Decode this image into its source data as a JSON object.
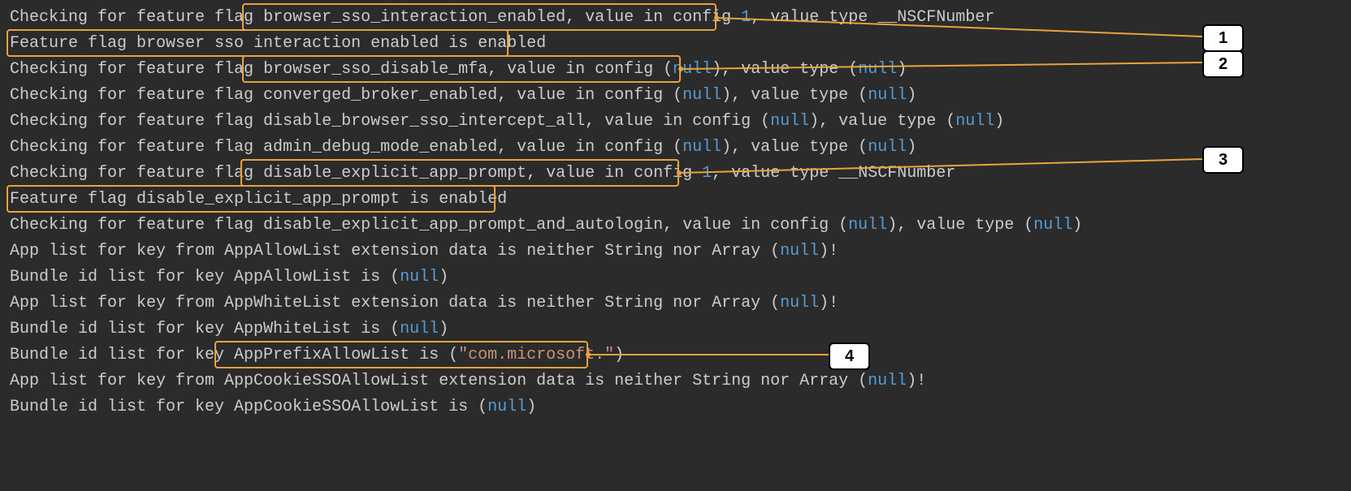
{
  "log": {
    "l1_pre": "Checking for feature flag ",
    "l1_hl": "browser_sso_interaction_enabled, value in config ",
    "l1_num": "1",
    "l1_post": ", value type __NSCFNumber",
    "l2_hl": "Feature flag browser sso interaction enabled is enabled",
    "l3_pre": "Checking for feature flag ",
    "l3_hl": "browser_sso_disable_mfa, value in config (",
    "l3_null": "null",
    "l3_hl2": ")",
    "l3_post1": ", value type (",
    "l3_null2": "null",
    "l3_post2": ")",
    "l4_pre": "Checking for feature flag converged_broker_enabled, value in config (",
    "l4_null": "null",
    "l4_mid": "), value type (",
    "l4_null2": "null",
    "l4_post": ")",
    "l5_pre": "Checking for feature flag disable_browser_sso_intercept_all, value in config (",
    "l5_null": "null",
    "l5_mid": "), value type (",
    "l5_null2": "null",
    "l5_post": ")",
    "l6_pre": "Checking for feature flag admin_debug_mode_enabled, value in config (",
    "l6_null": "null",
    "l6_mid": "), value type (",
    "l6_null2": "null",
    "l6_post": ")",
    "l7_pre": "Checking for feature flag ",
    "l7_hl": "disable_explicit_app_prompt, value in config ",
    "l7_num": "1",
    "l7_post": ", value type __NSCFNumber",
    "l8_hl": "Feature flag disable_explicit_app_prompt is enabled",
    "l9_pre": "Checking for feature flag disable_explicit_app_prompt_and_autologin, value in config (",
    "l9_null": "null",
    "l9_mid": "), value type (",
    "l9_null2": "null",
    "l9_post": ")",
    "l10_pre": "App list for key from AppAllowList extension data is neither String nor Array (",
    "l10_null": "null",
    "l10_post": ")!",
    "l11_pre": "Bundle id list for key AppAllowList is (",
    "l11_null": "null",
    "l11_post": ")",
    "l12_pre": "App list for key from AppWhiteList extension data is neither String nor Array (",
    "l12_null": "null",
    "l12_post": ")!",
    "l13_pre": "Bundle id list for key AppWhiteList is (",
    "l13_null": "null",
    "l13_post": ")",
    "l14_pre": "Bundle id list for key ",
    "l14_hl1": "AppPrefixAllowList is (",
    "l14_str": "\"com.microsoft.\"",
    "l14_hl2": ")",
    "l15_pre": "App list for key from AppCookieSSOAllowList extension data is neither String nor Array (",
    "l15_null": "null",
    "l15_post": ")!",
    "l16_pre": "Bundle id list for key AppCookieSSOAllowList is (",
    "l16_null": "null",
    "l16_post": ")"
  },
  "callouts": {
    "n1": "1",
    "n2": "2",
    "n3": "3",
    "n4": "4"
  }
}
